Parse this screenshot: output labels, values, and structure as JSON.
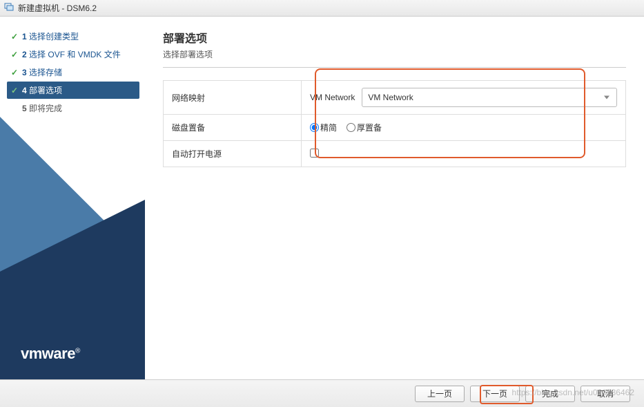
{
  "window": {
    "title": "新建虚拟机 - DSM6.2"
  },
  "steps": {
    "items": [
      {
        "num": "1",
        "label": "选择创建类型",
        "state": "done"
      },
      {
        "num": "2",
        "label": "选择 OVF 和 VMDK 文件",
        "state": "done"
      },
      {
        "num": "3",
        "label": "选择存储",
        "state": "done"
      },
      {
        "num": "4",
        "label": "部署选项",
        "state": "active"
      },
      {
        "num": "5",
        "label": "即将完成",
        "state": "pending"
      }
    ]
  },
  "page": {
    "title": "部署选项",
    "subtitle": "选择部署选项"
  },
  "form": {
    "network_mapping": {
      "label": "网络映射",
      "source": "VM Network",
      "selected": "VM Network"
    },
    "disk_provisioning": {
      "label": "磁盘置备",
      "options": {
        "thin": "精简",
        "thick": "厚置备"
      },
      "selected": "thin"
    },
    "power_on": {
      "label": "自动打开电源",
      "checked": false
    }
  },
  "buttons": {
    "back": "上一页",
    "next": "下一页",
    "finish": "完成",
    "cancel": "取消"
  },
  "logo": "vmware",
  "watermark": "https://blog.csdn.net/u013536462"
}
